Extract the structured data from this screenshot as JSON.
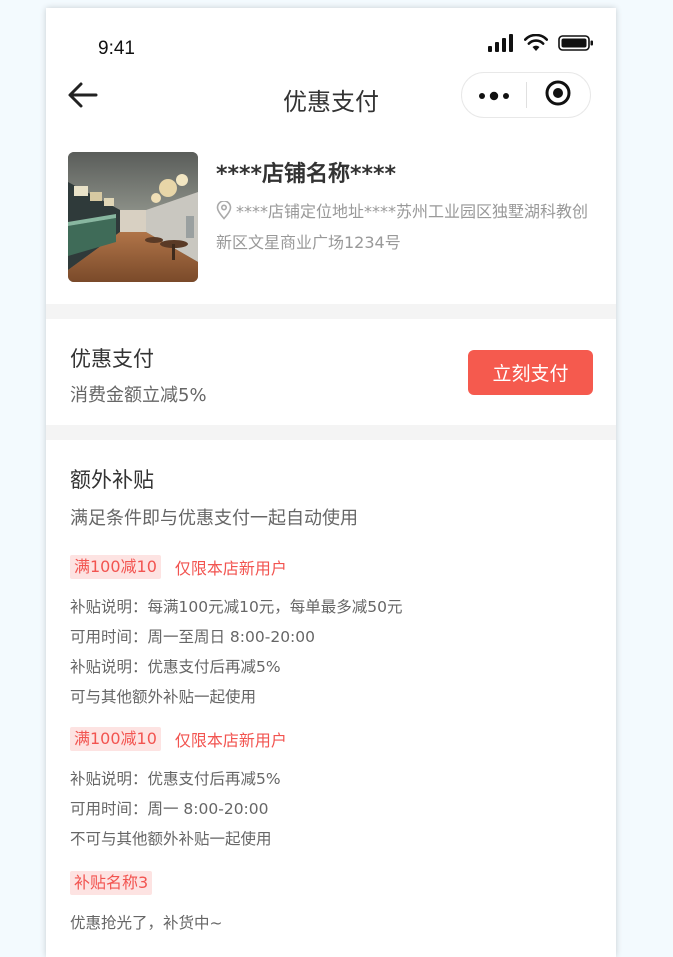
{
  "status_bar": {
    "time": "9:41",
    "icons": [
      "signal-icon",
      "wifi-icon",
      "battery-icon"
    ]
  },
  "nav": {
    "title": "优惠支付",
    "back_icon": "arrow-left-icon",
    "more_icon": "more-dots-icon",
    "close_icon": "target-circle-icon"
  },
  "store": {
    "name": "****店铺名称****",
    "address": "****店铺定位地址****苏州工业园区独墅湖科教创新区文星商业广场1234号",
    "location_icon": "location-pin-icon"
  },
  "pay": {
    "title": "优惠支付",
    "description": "消费金额立减5%",
    "button_label": "立刻支付"
  },
  "extra": {
    "title": "额外补贴",
    "description": "满足条件即与优惠支付一起自动使用",
    "coupons": [
      {
        "tag": "满100减10",
        "note": "仅限本店新用户",
        "lines": [
          "补贴说明：每满100元减10元，每单最多减50元",
          "可用时间：周一至周日  8:00-20:00",
          "补贴说明：优惠支付后再减5%",
          "可与其他额外补贴一起使用"
        ]
      },
      {
        "tag": "满100减10",
        "note": "仅限本店新用户",
        "lines": [
          "补贴说明：优惠支付后再减5%",
          "可用时间：周一  8:00-20:00",
          "不可与其他额外补贴一起使用"
        ]
      },
      {
        "tag": "补贴名称3",
        "note": "",
        "lines": [
          "优惠抢光了，补货中~"
        ]
      }
    ]
  },
  "colors": {
    "accent": "#f55a4e",
    "tag_bg": "#fde3e2",
    "tag_text": "#f25450",
    "page_bg": "#f3fafe"
  }
}
